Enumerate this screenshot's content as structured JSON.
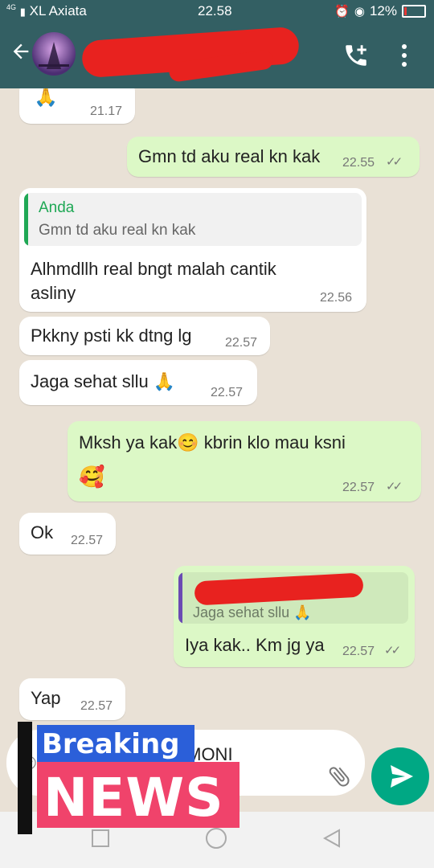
{
  "status_bar": {
    "network": "4G",
    "carrier": "XL Axiata",
    "time": "22.58",
    "battery": "12%",
    "battery_level": 0.12
  },
  "header": {
    "contact_name": "",
    "icons": [
      "back-arrow-icon",
      "call-add-icon",
      "more-vert-icon"
    ]
  },
  "messages": [
    {
      "dir": "in",
      "text": "🙏",
      "time": "21.17"
    },
    {
      "dir": "out",
      "text": "Gmn td aku real kn kak",
      "time": "22.55",
      "ticks": "✓✓"
    },
    {
      "dir": "in",
      "quote_author": "Anda",
      "quote_text": "Gmn td aku real kn kak",
      "text_line1": "Alhmdllh real bngt malah cantik",
      "text_line2": "asliny",
      "time": "22.56"
    },
    {
      "dir": "in",
      "text": "Pkkny psti kk dtng lg",
      "time": "22.57"
    },
    {
      "dir": "in",
      "text": "Jaga sehat sllu 🙏",
      "time": "22.57"
    },
    {
      "dir": "out",
      "text_line1": "Mksh ya kak😊 kbrin klo mau ksni",
      "text_line2": "🥰",
      "time": "22.57",
      "ticks": "✓✓"
    },
    {
      "dir": "in",
      "text": "Ok",
      "time": "22.57"
    },
    {
      "dir": "out",
      "quote_author": "",
      "quote_text": "Jaga sehat sllu 🙏",
      "text": "Iya kak.. Km jg ya",
      "time": "22.57",
      "ticks": "✓✓"
    },
    {
      "dir": "in",
      "text": "Yap",
      "time": "22.57"
    }
  ],
  "input": {
    "text": "IMONI",
    "icons": [
      "emoji-icon",
      "attach-icon",
      "send-icon"
    ]
  },
  "overlay": {
    "line1": "Breaking",
    "line2": "NEWS"
  },
  "colors": {
    "header": "#335f63",
    "outgoing_bubble": "#dcf8c6",
    "incoming_bubble": "#ffffff",
    "send_button": "#00a884",
    "overlay_pink": "#f0436b",
    "overlay_blue": "#2b5fd9",
    "redaction": "#e8221f"
  }
}
